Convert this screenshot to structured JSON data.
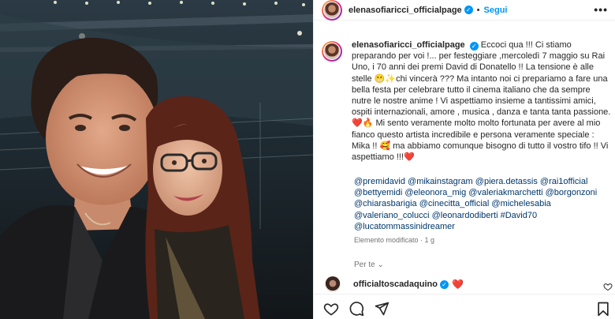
{
  "post": {
    "username": "elenasofiaricci_officialpage",
    "follow_label": "Segui",
    "separator": "•",
    "more_label": "•••",
    "verified_mark": "✓"
  },
  "caption": {
    "username": "elenasofiaricci_officialpage",
    "text_1": "Eccoci qua !!! Ci stiamo preparando per voi !... per festeggiare ,mercoledì 7 maggio su Rai Uno, i 70 anni dei premi David di Donatello !! La tensione è alle stelle 😬✨chi vincerà ??? Ma intanto noi ci prepariamo a fare una bella festa per celebrare tutto il cinema italiano che da sempre nutre le nostre anime ! Vi aspettiamo insieme a tantissimi amici, ospiti internazionali, amore , musica , danza e tanta tanta passione.",
    "emoji_heart": "❤️",
    "emoji_flame": "🔥",
    "text_2": "Mi sento veramente molto molto fortunata per avere al mio fianco questo artista incredibile e persona veramente speciale : Mika !! 🥰 ma abbiamo comunque bisogno di tutto il vostro tifo !! Vi aspettiamo !!!",
    "emoji_heart_end": "❤️"
  },
  "tags": [
    "@premidavid",
    "@mikainstagram",
    "@piera.detassis",
    "@rai1official",
    "@bettyemidi",
    "@eleonora_mig",
    "@valeriakmarchetti",
    "@borgonzoni",
    "@chiarasbarigia",
    "@cinecitta_official",
    "@michelesabia",
    "@valeriano_colucci",
    "@leonardodiberti",
    "#David70",
    "@lucatommassinidreamer"
  ],
  "edited_label": "Elemento modificato · 1 g",
  "see_translation": "Per te ⌄",
  "comment": {
    "username": "officialtoscadaquino",
    "text": "❤️"
  },
  "icons": {
    "like": "heart-icon",
    "comment": "comment-bubble-icon",
    "share": "paper-plane-icon",
    "save": "bookmark-icon",
    "verified": "verified-badge-icon"
  },
  "colors": {
    "accent": "#0095f6",
    "text": "#262626",
    "link": "#00376b",
    "muted": "#737373",
    "heart": "#e0245e"
  }
}
